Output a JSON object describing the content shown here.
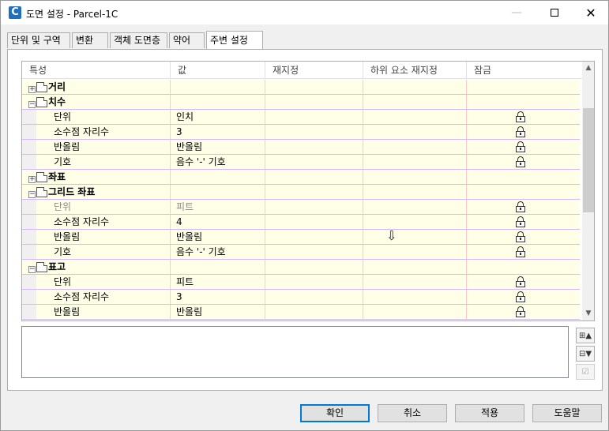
{
  "window": {
    "title": "도면 설정 - Parcel-1C",
    "icon_letter": "C",
    "minimize_glyph": "—",
    "close_glyph": "✕"
  },
  "tabs": [
    {
      "label": "단위 및 구역",
      "active": false
    },
    {
      "label": "변환",
      "active": false
    },
    {
      "label": "객체 도면층",
      "active": false
    },
    {
      "label": "약어",
      "active": false
    },
    {
      "label": "주변 설정",
      "active": true
    }
  ],
  "grid": {
    "columns": [
      "특성",
      "값",
      "재지정",
      "하위 요소 재지정",
      "잠금"
    ],
    "rows": [
      {
        "type": "category",
        "label": "거리",
        "expander": "+"
      },
      {
        "type": "category",
        "label": "치수",
        "expander": "−"
      },
      {
        "type": "property",
        "label": "단위",
        "value": "인치",
        "locked": true
      },
      {
        "type": "property",
        "label": "소수점 자리수",
        "value": "3",
        "locked": true
      },
      {
        "type": "property",
        "label": "반올림",
        "value": "반올림",
        "locked": true
      },
      {
        "type": "property",
        "label": "기호",
        "value": "음수 '-' 기호",
        "locked": true
      },
      {
        "type": "category",
        "label": "좌표",
        "expander": "+"
      },
      {
        "type": "category",
        "label": "그리드 좌표",
        "expander": "−"
      },
      {
        "type": "property",
        "label": "단위",
        "value": "피트",
        "locked": true,
        "disabled": true
      },
      {
        "type": "property",
        "label": "소수점 자리수",
        "value": "4",
        "locked": true
      },
      {
        "type": "property",
        "label": "반올림",
        "value": "반올림",
        "locked": true
      },
      {
        "type": "property",
        "label": "기호",
        "value": "음수 '-' 기호",
        "locked": true
      },
      {
        "type": "category",
        "label": "표고",
        "expander": "−"
      },
      {
        "type": "property",
        "label": "단위",
        "value": "피트",
        "locked": true
      },
      {
        "type": "property",
        "label": "소수점 자리수",
        "value": "3",
        "locked": true
      },
      {
        "type": "property",
        "label": "반올림",
        "value": "반올림",
        "locked": true
      }
    ]
  },
  "side_buttons": [
    {
      "name": "expand-all-button",
      "glyph": "⊞▲"
    },
    {
      "name": "collapse-all-button",
      "glyph": "⊟▼"
    },
    {
      "name": "toggle-override-button",
      "glyph": "☑",
      "disabled": true
    }
  ],
  "buttons": {
    "ok": "확인",
    "cancel": "취소",
    "apply": "적용",
    "help": "도움말"
  },
  "colors": {
    "row_background": "#ffffe7",
    "row_separator": "#d4b6ff",
    "column_separator": "#ffc9c9",
    "default_button_border": "#0078d7"
  }
}
